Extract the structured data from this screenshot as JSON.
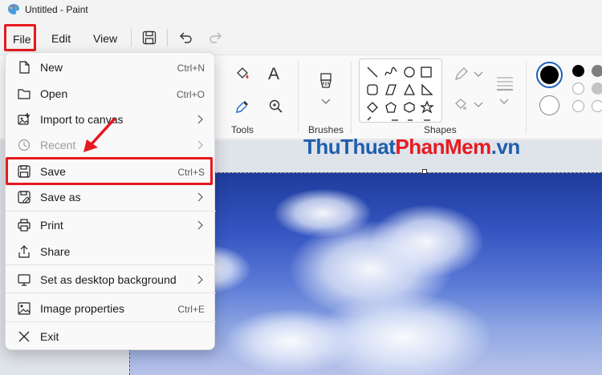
{
  "window": {
    "title": "Untitled - Paint"
  },
  "menubar": {
    "file": "File",
    "edit": "Edit",
    "view": "View"
  },
  "ribbon": {
    "tools_label": "Tools",
    "brushes_label": "Brushes",
    "shapes_label": "Shapes",
    "text_tool": "A"
  },
  "watermark": {
    "part1": "ThuThuat",
    "part2": "PhanMem",
    "part3": ".vn"
  },
  "file_menu": [
    {
      "label": "New",
      "shortcut": "Ctrl+N",
      "icon": "new-file-icon"
    },
    {
      "label": "Open",
      "shortcut": "Ctrl+O",
      "icon": "folder-icon"
    },
    {
      "label": "Import to canvas",
      "submenu": true,
      "icon": "import-icon"
    },
    {
      "label": "Recent",
      "submenu": true,
      "disabled": true,
      "icon": "clock-icon"
    },
    {
      "label": "Save",
      "shortcut": "Ctrl+S",
      "icon": "save-icon"
    },
    {
      "label": "Save as",
      "submenu": true,
      "icon": "save-as-icon"
    },
    {
      "label": "Print",
      "submenu": true,
      "icon": "printer-icon"
    },
    {
      "label": "Share",
      "icon": "share-icon"
    },
    {
      "label": "Set as desktop background",
      "submenu": true,
      "icon": "desktop-icon"
    },
    {
      "label": "Image properties",
      "shortcut": "Ctrl+E",
      "icon": "image-properties-icon"
    },
    {
      "label": "Exit",
      "icon": "close-icon"
    }
  ],
  "colors": {
    "highlight": "#e6191f",
    "primary": "#000000",
    "secondary": "#ffffff"
  }
}
